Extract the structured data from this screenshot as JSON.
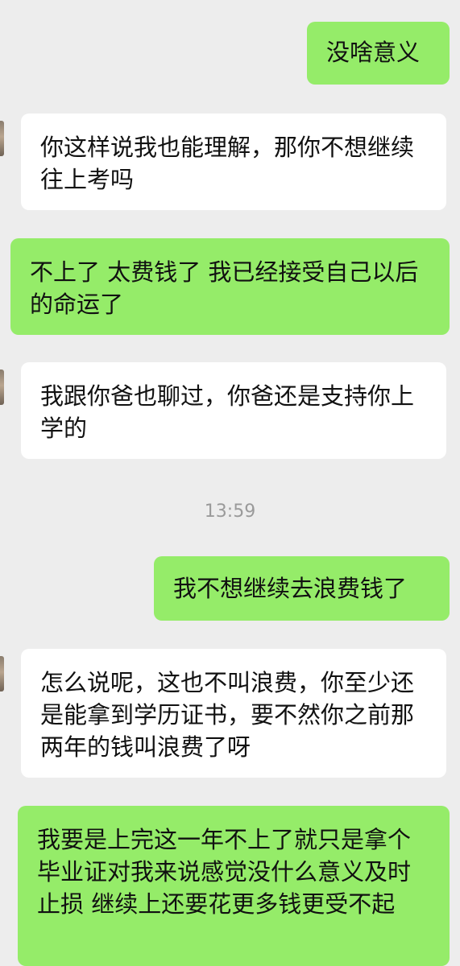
{
  "conversation": {
    "messages": [
      {
        "side": "sent",
        "text": "没啥意义"
      },
      {
        "side": "received",
        "text": "你这样说我也能理解，那你不想继续往上考吗"
      },
      {
        "side": "sent",
        "text": "不上了 太费钱了 我已经接受自己以后的命运了"
      },
      {
        "side": "received",
        "text": "我跟你爸也聊过，你爸还是支持你上学的"
      },
      {
        "side": "sent",
        "text": "我不想继续去浪费钱了"
      },
      {
        "side": "received",
        "text": "怎么说呢，这也不叫浪费，你至少还是能拿到学历证书，要不然你之前那两年的钱叫浪费了呀"
      },
      {
        "side": "sent",
        "text": "我要是上完这一年不上了就只是拿个毕业证对我来说感觉没什么意义及时止损 继续上还要花更多钱更受不起"
      }
    ],
    "timestamp": "13:59"
  },
  "colors": {
    "background": "#ededed",
    "sent_bubble": "#95ec69",
    "received_bubble": "#ffffff",
    "timestamp_text": "#9a9a9a"
  }
}
